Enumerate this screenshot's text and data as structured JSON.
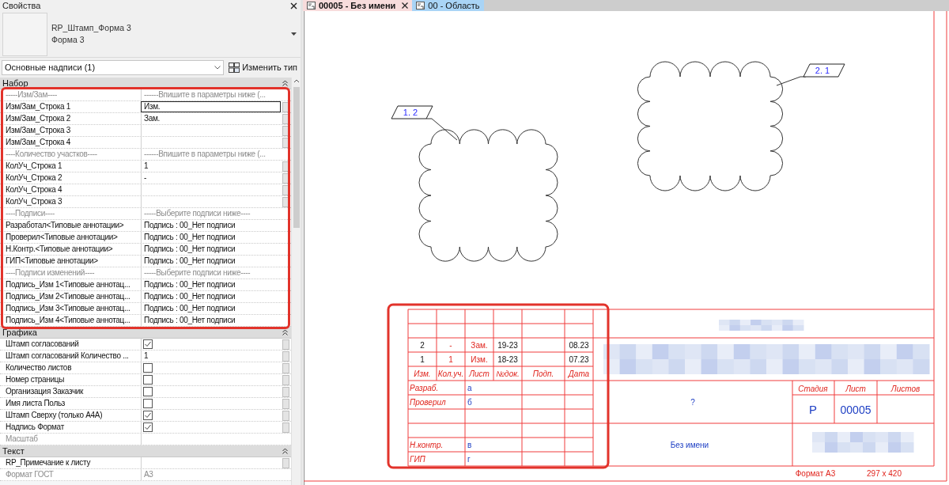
{
  "properties": {
    "title": "Свойства",
    "type_name": "RP_Штамп_Форма 3",
    "type_subname": "Форма 3",
    "category": "Основные надписи (1)",
    "edit_type_button": "Изменить тип",
    "groups": [
      {
        "name": "Набор",
        "rows": [
          {
            "kind": "separator",
            "name": "-----Изм/Зам----",
            "value": "------Впишите в параметры ниже (...",
            "linked": false,
            "selected": false
          },
          {
            "kind": "text",
            "name": "Изм/Зам_Строка 1",
            "value": "Изм.",
            "disabled": false,
            "linked": true,
            "selected": true
          },
          {
            "kind": "text",
            "name": "Изм/Зам_Строка 2",
            "value": "Зам.",
            "disabled": false,
            "linked": true,
            "selected": false
          },
          {
            "kind": "text",
            "name": "Изм/Зам_Строка 3",
            "disabled": false,
            "linked": true,
            "selected": false
          },
          {
            "kind": "text",
            "name": "Изм/Зам_Строка 4",
            "disabled": false,
            "linked": true,
            "selected": false
          },
          {
            "kind": "separator",
            "name": "----Количество участков----",
            "value": "------Впишите в параметры ниже (...",
            "linked": false,
            "selected": false
          },
          {
            "kind": "text",
            "name": "КолУч_Строка 1",
            "value": "1",
            "disabled": false,
            "linked": true,
            "selected": false
          },
          {
            "kind": "text",
            "name": "КолУч_Строка 2",
            "value": "-",
            "disabled": false,
            "linked": true,
            "selected": false
          },
          {
            "kind": "text",
            "name": "КолУч_Строка 4",
            "disabled": false,
            "linked": true,
            "selected": false
          },
          {
            "kind": "text",
            "name": "КолУч_Строка 3",
            "disabled": false,
            "linked": true,
            "selected": false
          },
          {
            "kind": "separator",
            "name": "----Подписи----",
            "value": "-----Выберите подписи ниже----",
            "linked": false,
            "selected": false
          },
          {
            "kind": "text",
            "name": "Разработал<Типовые аннотации>",
            "value": "Подпись : 00_Нет подписи",
            "disabled": false,
            "linked": false,
            "selected": false
          },
          {
            "kind": "text",
            "name": "Проверил<Типовые аннотации>",
            "value": "Подпись : 00_Нет подписи",
            "disabled": false,
            "linked": false,
            "selected": false
          },
          {
            "kind": "text",
            "name": "Н.Контр.<Типовые аннотации>",
            "value": "Подпись : 00_Нет подписи",
            "disabled": false,
            "linked": false,
            "selected": false
          },
          {
            "kind": "text",
            "name": "ГИП<Типовые аннотации>",
            "value": "Подпись : 00_Нет подписи",
            "disabled": false,
            "linked": false,
            "selected": false
          },
          {
            "kind": "separator",
            "name": "----Подписи изменений----",
            "value": "-----Выберите подписи ниже----",
            "linked": false,
            "selected": false
          },
          {
            "kind": "text",
            "name": "Подпись_Изм 1<Типовые аннотац...",
            "value": "Подпись : 00_Нет подписи",
            "disabled": false,
            "linked": false,
            "selected": false
          },
          {
            "kind": "text",
            "name": "Подпись_Изм 2<Типовые аннотац...",
            "value": "Подпись : 00_Нет подписи",
            "disabled": false,
            "linked": false,
            "selected": false
          },
          {
            "kind": "text",
            "name": "Подпись_Изм 3<Типовые аннотац...",
            "value": "Подпись : 00_Нет подписи",
            "disabled": false,
            "linked": false,
            "selected": false
          },
          {
            "kind": "text",
            "name": "Подпись_Изм 4<Типовые аннотац...",
            "value": "Подпись : 00_Нет подписи",
            "disabled": false,
            "linked": false,
            "selected": false
          }
        ]
      },
      {
        "name": "Графика",
        "rows": [
          {
            "kind": "check",
            "name": "Штамп согласований",
            "checked": true,
            "disabled": false,
            "linked": true,
            "selected": false
          },
          {
            "kind": "text",
            "name": "Штамп согласований Количество ...",
            "value": "1",
            "disabled": false,
            "linked": true,
            "selected": false
          },
          {
            "kind": "check",
            "name": "Количество листов",
            "checked": false,
            "disabled": false,
            "linked": true,
            "selected": false
          },
          {
            "kind": "check",
            "name": "Номер страницы",
            "checked": false,
            "disabled": false,
            "linked": true,
            "selected": false
          },
          {
            "kind": "check",
            "name": "Организация Заказчик",
            "checked": false,
            "disabled": false,
            "linked": true,
            "selected": false
          },
          {
            "kind": "check",
            "name": "Имя листа Польз",
            "checked": false,
            "disabled": false,
            "linked": true,
            "selected": false
          },
          {
            "kind": "check",
            "name": "Штамп Сверху (только А4А)",
            "checked": true,
            "disabled": false,
            "linked": true,
            "selected": false
          },
          {
            "kind": "check",
            "name": "Надпись Формат",
            "checked": true,
            "disabled": false,
            "linked": true,
            "selected": false
          },
          {
            "kind": "text",
            "name": "Масштаб",
            "disabled": true,
            "linked": false,
            "selected": false
          }
        ]
      },
      {
        "name": "Текст",
        "rows": [
          {
            "kind": "text",
            "name": "RP_Примечание к листу",
            "disabled": false,
            "linked": true,
            "selected": false
          },
          {
            "kind": "text",
            "name": "Формат ГОСТ",
            "value": "А3",
            "disabled": true,
            "linked": false,
            "selected": false
          }
        ]
      }
    ]
  },
  "canvas": {
    "tabs": [
      {
        "label": "00005 - Без имени",
        "selected": true
      },
      {
        "label": "00 - Область",
        "selected": false
      }
    ],
    "revision_tags": [
      {
        "label": "1. 2"
      },
      {
        "label": "2. 1"
      }
    ],
    "title_block": {
      "revisions": [
        {
          "change": "2",
          "count": "-",
          "sheet": "Зам.",
          "doc": "19-23",
          "date": "08.23"
        },
        {
          "change": "1",
          "count": "1",
          "sheet": "Изм.",
          "doc": "18-23",
          "date": "07.23"
        }
      ],
      "revision_headers": [
        "Изм.",
        "Кол.уч.",
        "Лист",
        "№док.",
        "Подп.",
        "Дата"
      ],
      "signers_top": [
        {
          "role": "Разраб.",
          "name": "а"
        },
        {
          "role": "Проверил",
          "name": "б"
        }
      ],
      "signers_bottom": [
        {
          "role": "Н.контр.",
          "name": "в"
        },
        {
          "role": "ГИП",
          "name": "г"
        }
      ],
      "object_name": "?",
      "sheet_name": "Без имени",
      "stage_headers": [
        "Стадия",
        "Лист",
        "Листов"
      ],
      "stage": "Р",
      "sheet_number": "00005",
      "format": "Формат А3",
      "size": "297 x 420"
    }
  }
}
